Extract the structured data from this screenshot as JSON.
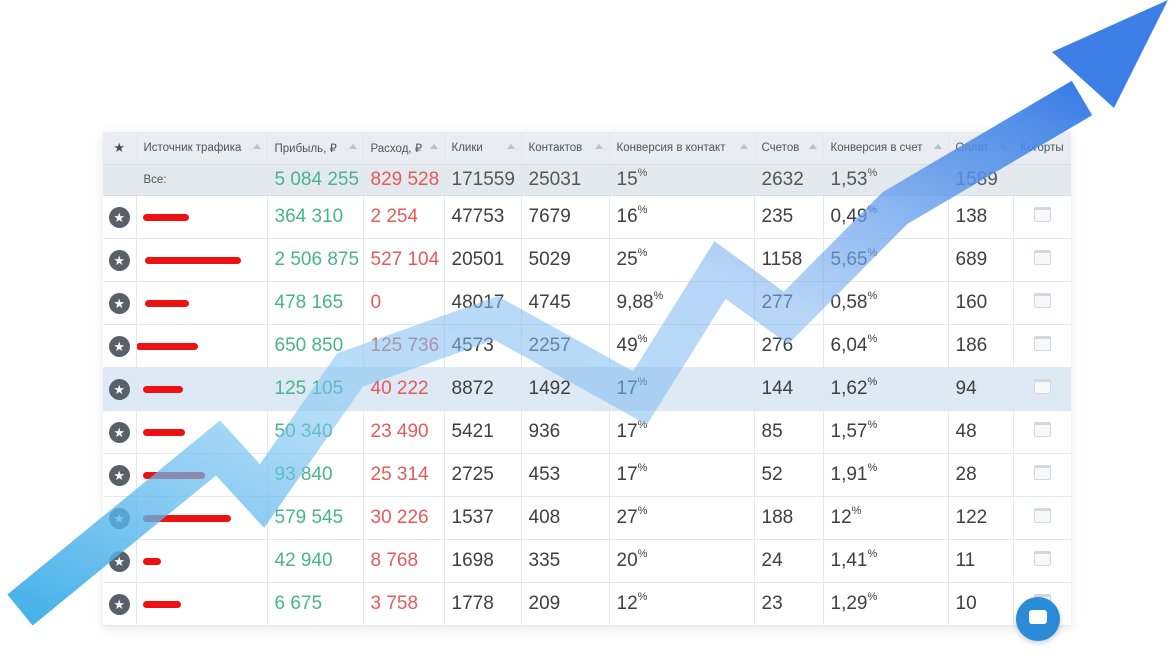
{
  "columns": [
    {
      "key": "star",
      "label": "★"
    },
    {
      "key": "source",
      "label": "Источник трафика"
    },
    {
      "key": "profit",
      "label": "Прибыль, ₽"
    },
    {
      "key": "expense",
      "label": "Расход, ₽"
    },
    {
      "key": "clicks",
      "label": "Клики"
    },
    {
      "key": "contacts",
      "label": "Контактов"
    },
    {
      "key": "conv_contact",
      "label": "Конверсия в контакт"
    },
    {
      "key": "invoices",
      "label": "Счетов"
    },
    {
      "key": "conv_invoice",
      "label": "Конверсия в счет"
    },
    {
      "key": "payments",
      "label": "Оплат"
    },
    {
      "key": "cohorts",
      "label": "Когорты"
    }
  ],
  "total": {
    "label": "Все:",
    "profit": "5 084 255",
    "expense": "829 528",
    "clicks": "171559",
    "contacts": "25031",
    "conv_contact": "15",
    "invoices": "2632",
    "conv_invoice": "1,53",
    "payments": "1589"
  },
  "percent_sign": "%",
  "rows": [
    {
      "source": "",
      "profit": "364 310",
      "expense": "2 254",
      "clicks": "47753",
      "contacts": "7679",
      "conv_contact": "16",
      "invoices": "235",
      "conv_invoice": "0,49",
      "payments": "138"
    },
    {
      "source": "",
      "profit": "2 506 875",
      "expense": "527 104",
      "clicks": "20501",
      "contacts": "5029",
      "conv_contact": "25",
      "invoices": "1158",
      "conv_invoice": "5,65",
      "payments": "689"
    },
    {
      "source": "",
      "profit": "478 165",
      "expense": "0",
      "clicks": "48017",
      "contacts": "4745",
      "conv_contact": "9,88",
      "invoices": "277",
      "conv_invoice": "0,58",
      "payments": "160"
    },
    {
      "source": "",
      "profit": "650 850",
      "expense": "125 736",
      "clicks": "4573",
      "contacts": "2257",
      "conv_contact": "49",
      "invoices": "276",
      "conv_invoice": "6,04",
      "payments": "186"
    },
    {
      "source": "",
      "profit": "125 105",
      "expense": "40 222",
      "clicks": "8872",
      "contacts": "1492",
      "conv_contact": "17",
      "invoices": "144",
      "conv_invoice": "1,62",
      "payments": "94"
    },
    {
      "source": "",
      "profit": "50 340",
      "expense": "23 490",
      "clicks": "5421",
      "contacts": "936",
      "conv_contact": "17",
      "invoices": "85",
      "conv_invoice": "1,57",
      "payments": "48"
    },
    {
      "source": "",
      "profit": "93 840",
      "expense": "25 314",
      "clicks": "2725",
      "contacts": "453",
      "conv_contact": "17",
      "invoices": "52",
      "conv_invoice": "1,91",
      "payments": "28"
    },
    {
      "source": "",
      "profit": "579 545",
      "expense": "30 226",
      "clicks": "1537",
      "contacts": "408",
      "conv_contact": "27",
      "invoices": "188",
      "conv_invoice": "12",
      "payments": "122"
    },
    {
      "source": "",
      "profit": "42 940",
      "expense": "8 768",
      "clicks": "1698",
      "contacts": "335",
      "conv_contact": "20",
      "invoices": "24",
      "conv_invoice": "1,41",
      "payments": "11"
    },
    {
      "source": "",
      "profit": "6 675",
      "expense": "3 758",
      "clicks": "1778",
      "contacts": "209",
      "conv_contact": "12",
      "invoices": "23",
      "conv_invoice": "1,29",
      "payments": "10"
    }
  ],
  "highlighted_row": 4,
  "colors": {
    "profit": "#49b48c",
    "expense": "#e55a5a",
    "redaction": "#ee1111",
    "arrow_start": "#3daee9",
    "arrow_end": "#3d7fe6",
    "highlight": "#dde9f4"
  },
  "icons": {
    "star_header": "star-icon",
    "row_star": "star-circle-icon",
    "cohort": "calendar-icon",
    "chat": "chat-icon"
  }
}
